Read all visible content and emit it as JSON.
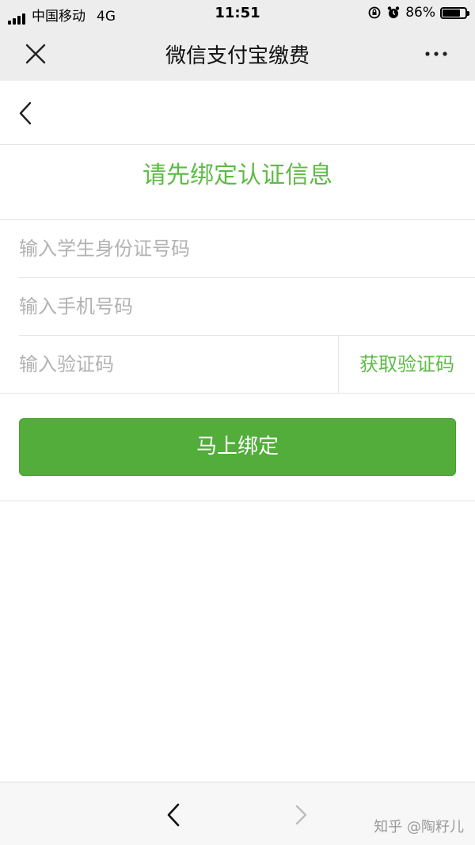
{
  "status_bar": {
    "carrier": "中国移动",
    "network": "4G",
    "time": "11:51",
    "battery_text": "86%",
    "battery_level": 0.86
  },
  "title_bar": {
    "title": "微信支付宝缴费",
    "close_icon": "close-icon",
    "more_icon": "more-icon"
  },
  "page": {
    "back_icon": "chevron-left-icon",
    "heading": "请先绑定认证信息"
  },
  "form": {
    "student_id_placeholder": "输入学生身份证号码",
    "student_id_value": "",
    "phone_placeholder": "输入手机号码",
    "phone_value": "",
    "code_placeholder": "输入验证码",
    "code_value": "",
    "get_code_label": "获取验证码",
    "submit_label": "马上绑定"
  },
  "toolbar": {
    "back_icon": "chevron-left-icon",
    "forward_icon": "chevron-right-icon",
    "watermark": "知乎 @陶籽儿"
  },
  "colors": {
    "accent": "#5dbb46",
    "button": "#52ad3a",
    "header_bg": "#ededed"
  }
}
